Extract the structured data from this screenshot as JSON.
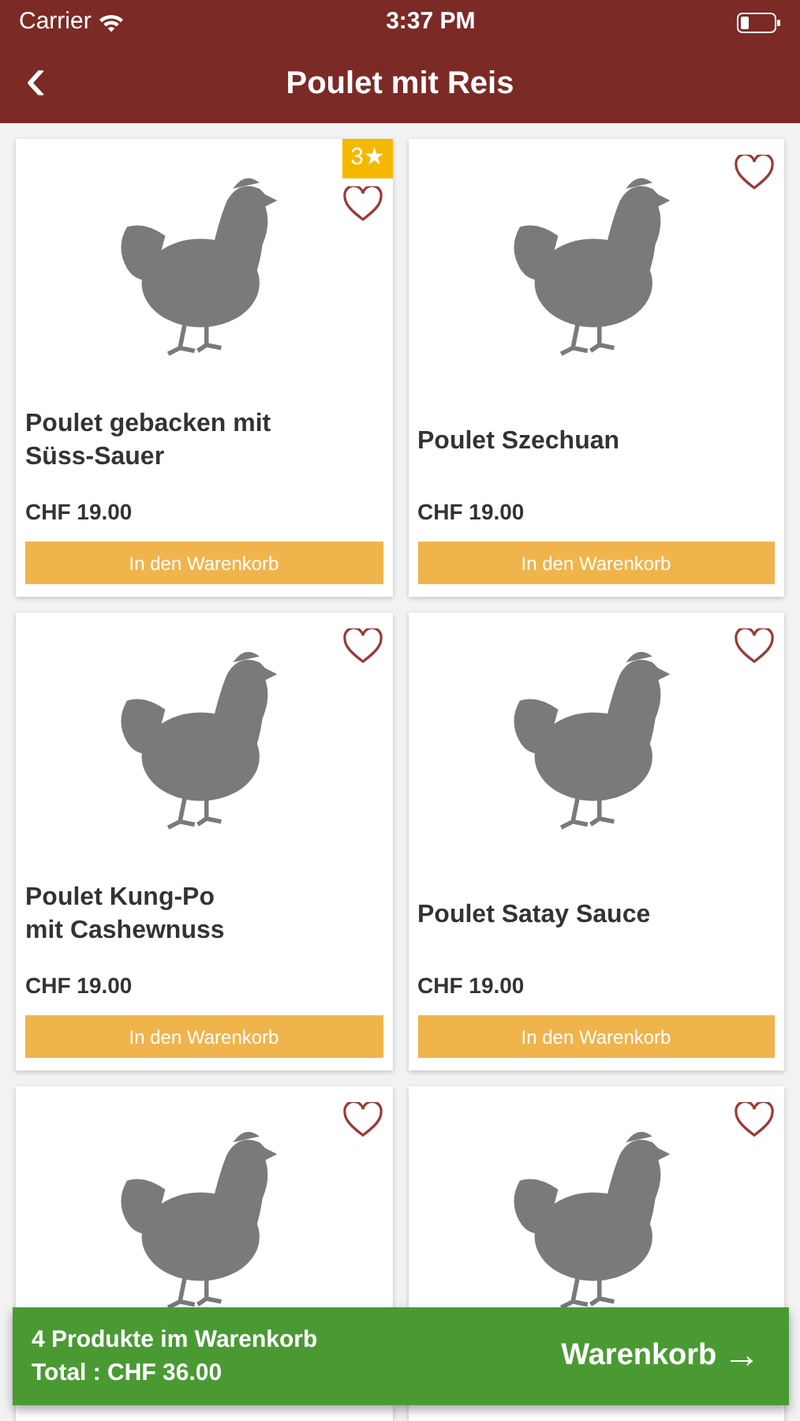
{
  "status_bar": {
    "carrier": "Carrier",
    "time": "3:37 PM"
  },
  "nav": {
    "back": "‹",
    "title": "Poulet mit Reis"
  },
  "products": [
    {
      "name": "Poulet gebacken mit\nSüss-Sauer",
      "price": "CHF 19.00",
      "button": "In den Warenkorb",
      "favorite": false,
      "badge": "3★"
    },
    {
      "name": "Poulet Szechuan",
      "price": "CHF 19.00",
      "button": "In den Warenkorb",
      "favorite": false
    },
    {
      "name": "Poulet Kung-Po\nmit Cashewnuss",
      "price": "CHF 19.00",
      "button": "In den Warenkorb",
      "favorite": false
    },
    {
      "name": "Poulet Satay Sauce",
      "price": "CHF 19.00",
      "button": "In den Warenkorb",
      "favorite": false
    },
    {
      "favorite": false
    },
    {
      "favorite": false
    }
  ],
  "cart": {
    "count": "4 Produkte im Warenkorb",
    "total": "Total : CHF 36.00",
    "button": "Warenkorb",
    "arrow": "→"
  }
}
